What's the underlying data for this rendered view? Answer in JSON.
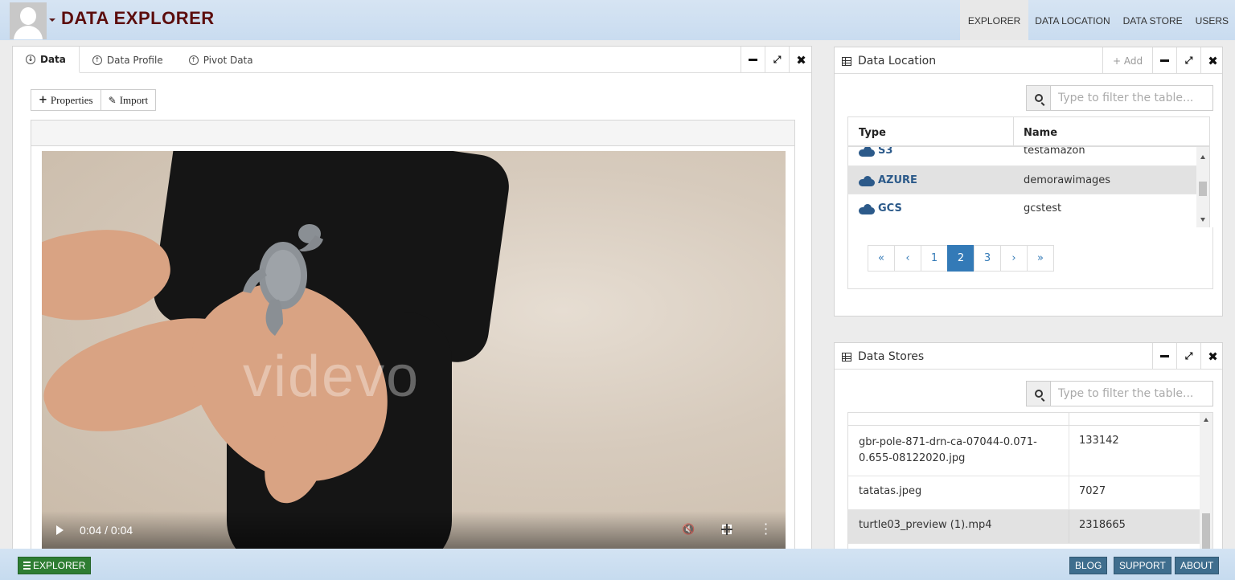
{
  "header": {
    "app_title": "DATA EXPLORER",
    "nav": [
      "EXPLORER",
      "DATA LOCATION",
      "DATA STORE",
      "USERS"
    ]
  },
  "data_panel": {
    "tabs": [
      "Data",
      "Data Profile",
      "Pivot Data"
    ],
    "buttons": {
      "properties": "Properties",
      "import": "Import"
    },
    "video": {
      "watermark": "videvo",
      "time": "0:04 / 0:04",
      "progress": 1.0
    }
  },
  "data_location": {
    "title": "Data Location",
    "add_label": "Add",
    "filter_placeholder": "Type to filter the table...",
    "columns": [
      "Type",
      "Name"
    ],
    "rows": [
      {
        "type": "S3",
        "name": "testamazon"
      },
      {
        "type": "AZURE",
        "name": "demorawimages"
      },
      {
        "type": "GCS",
        "name": "gcstest"
      }
    ],
    "pager": [
      "«",
      "‹",
      "1",
      "2",
      "3",
      "›",
      "»"
    ],
    "current_page": "2"
  },
  "data_stores": {
    "title": "Data Stores",
    "filter_placeholder": "Type to filter the table...",
    "rows": [
      {
        "name_line1": "gbr-pole-871-drn-ca-07044-0.071-",
        "name_line2": "0.655-08122020.jpg",
        "size": "133142"
      },
      {
        "name": "tatatas.jpeg",
        "size": "7027"
      },
      {
        "name": "turtle03_preview (1).mp4",
        "size": "2318665"
      }
    ]
  },
  "footer": {
    "explorer": "EXPLORER",
    "links": [
      "BLOG",
      "SUPPORT",
      "ABOUT"
    ]
  },
  "colors": {
    "title": "#5c0d0d",
    "link": "#2c5a8a",
    "accent": "#337ab7",
    "footer_green": "#2e7d32",
    "footer_blue": "#3f6e8e"
  }
}
